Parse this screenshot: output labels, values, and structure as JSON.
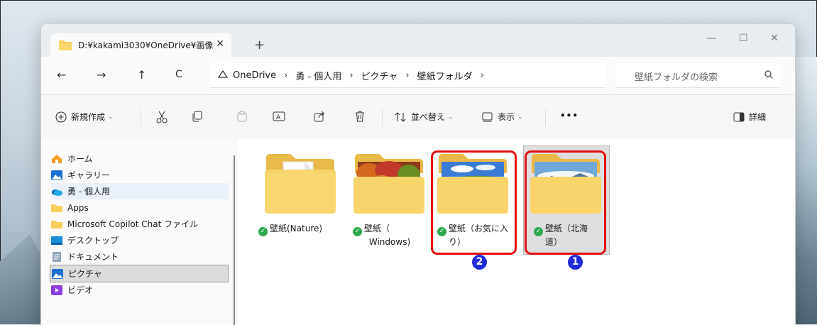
{
  "window": {
    "tab_title": "D:¥kakami3030¥OneDrive¥画像",
    "tab_close": "✕",
    "new_tab": "+",
    "minimize": "—",
    "maximize": "☐",
    "close": "✕"
  },
  "address": {
    "back": "←",
    "forward": "→",
    "up": "↑",
    "refresh": "C",
    "crumbs": [
      "OneDrive",
      "勇 - 個人用",
      "ピクチャ",
      "壁紙フォルダ"
    ],
    "sep": "›",
    "search_placeholder": "壁紙フォルダの検索"
  },
  "toolbar": {
    "new_label": "新規作成",
    "sort_label": "並べ替え",
    "view_label": "表示",
    "more_label": "•••",
    "details_label": "詳細",
    "chev": "⌄"
  },
  "sidebar": {
    "items": [
      {
        "label": "ホーム",
        "icon": "home-icon"
      },
      {
        "label": "ギャラリー",
        "icon": "gallery-icon"
      },
      {
        "label": "勇 - 個人用",
        "icon": "onedrive-cloud-icon"
      },
      {
        "label": "Apps",
        "icon": "folder-icon"
      },
      {
        "label": "Microsoft Copilot Chat ファイル",
        "icon": "folder-icon"
      },
      {
        "label": "デスクトップ",
        "icon": "desktop-icon"
      },
      {
        "label": "ドキュメント",
        "icon": "document-icon"
      },
      {
        "label": "ピクチャ",
        "icon": "pictures-icon"
      },
      {
        "label": "ビデオ",
        "icon": "video-icon"
      }
    ]
  },
  "folders": [
    {
      "line1": "壁紙(Nature)",
      "line2": "",
      "thumb": "blank-page"
    },
    {
      "line1": "壁紙（",
      "line2": "Windows)",
      "thumb": "autumn-trees"
    },
    {
      "line1": "壁紙（お気に入",
      "line2": "り）",
      "thumb": "sky-grass"
    },
    {
      "line1": "壁紙（北海",
      "line2": "道）",
      "thumb": "mountain-clouds"
    }
  ],
  "status_check": "✓",
  "annotations": {
    "badge_favorites": "2",
    "badge_hokkaido": "1"
  },
  "colors": {
    "accent_red": "#e01010",
    "badge_blue": "#1f2bd8",
    "sync_green": "#2fa84f",
    "folder_yellow": "#f7cf5c"
  }
}
